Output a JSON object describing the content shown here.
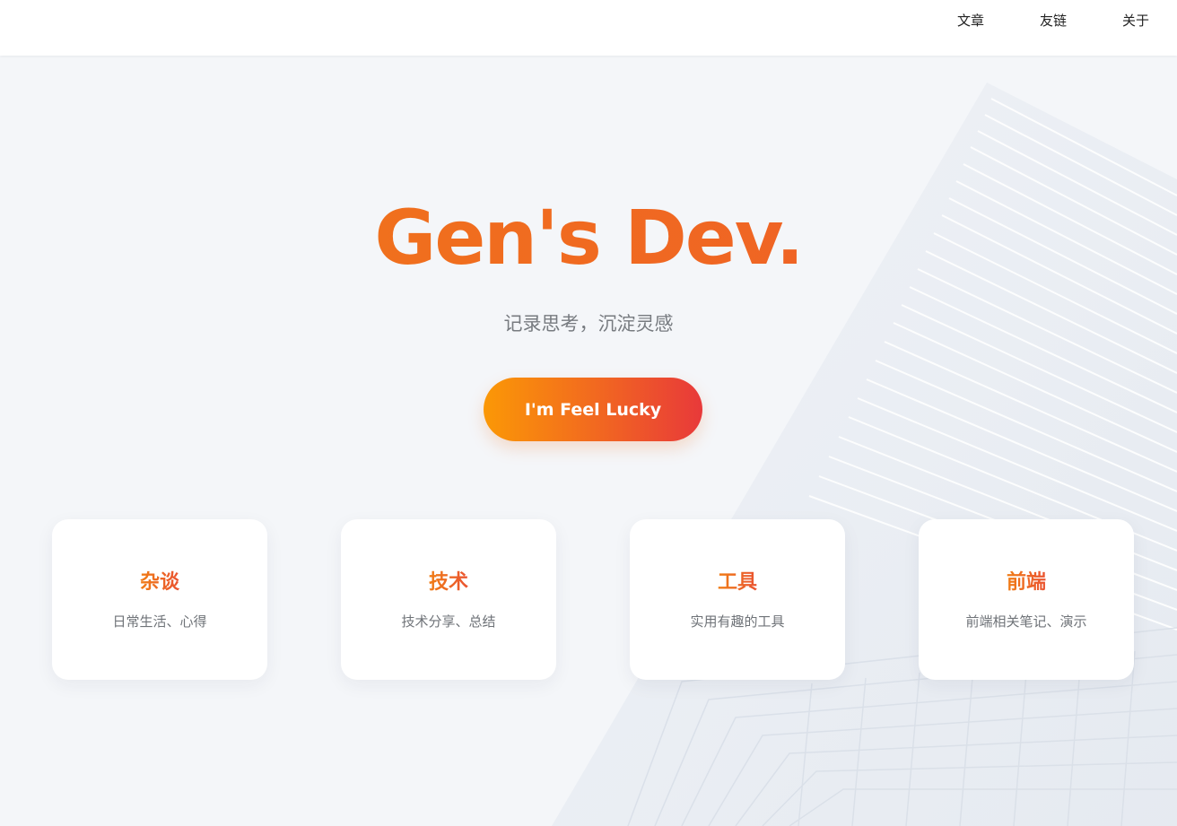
{
  "nav": {
    "items": [
      {
        "label": "文章"
      },
      {
        "label": "友链"
      },
      {
        "label": "关于"
      }
    ]
  },
  "hero": {
    "title": "Gen's Dev.",
    "subtitle": "记录思考，沉淀灵感",
    "button_label": "I'm Feel Lucky"
  },
  "categories": [
    {
      "title": "杂谈",
      "description": "日常生活、心得"
    },
    {
      "title": "技术",
      "description": "技术分享、总结"
    },
    {
      "title": "工具",
      "description": "实用有趣的工具"
    },
    {
      "title": "前端",
      "description": "前端相关笔记、演示"
    }
  ],
  "colors": {
    "accent_start": "#fb9806",
    "accent_end": "#e8393a",
    "background": "#f4f6f9"
  }
}
